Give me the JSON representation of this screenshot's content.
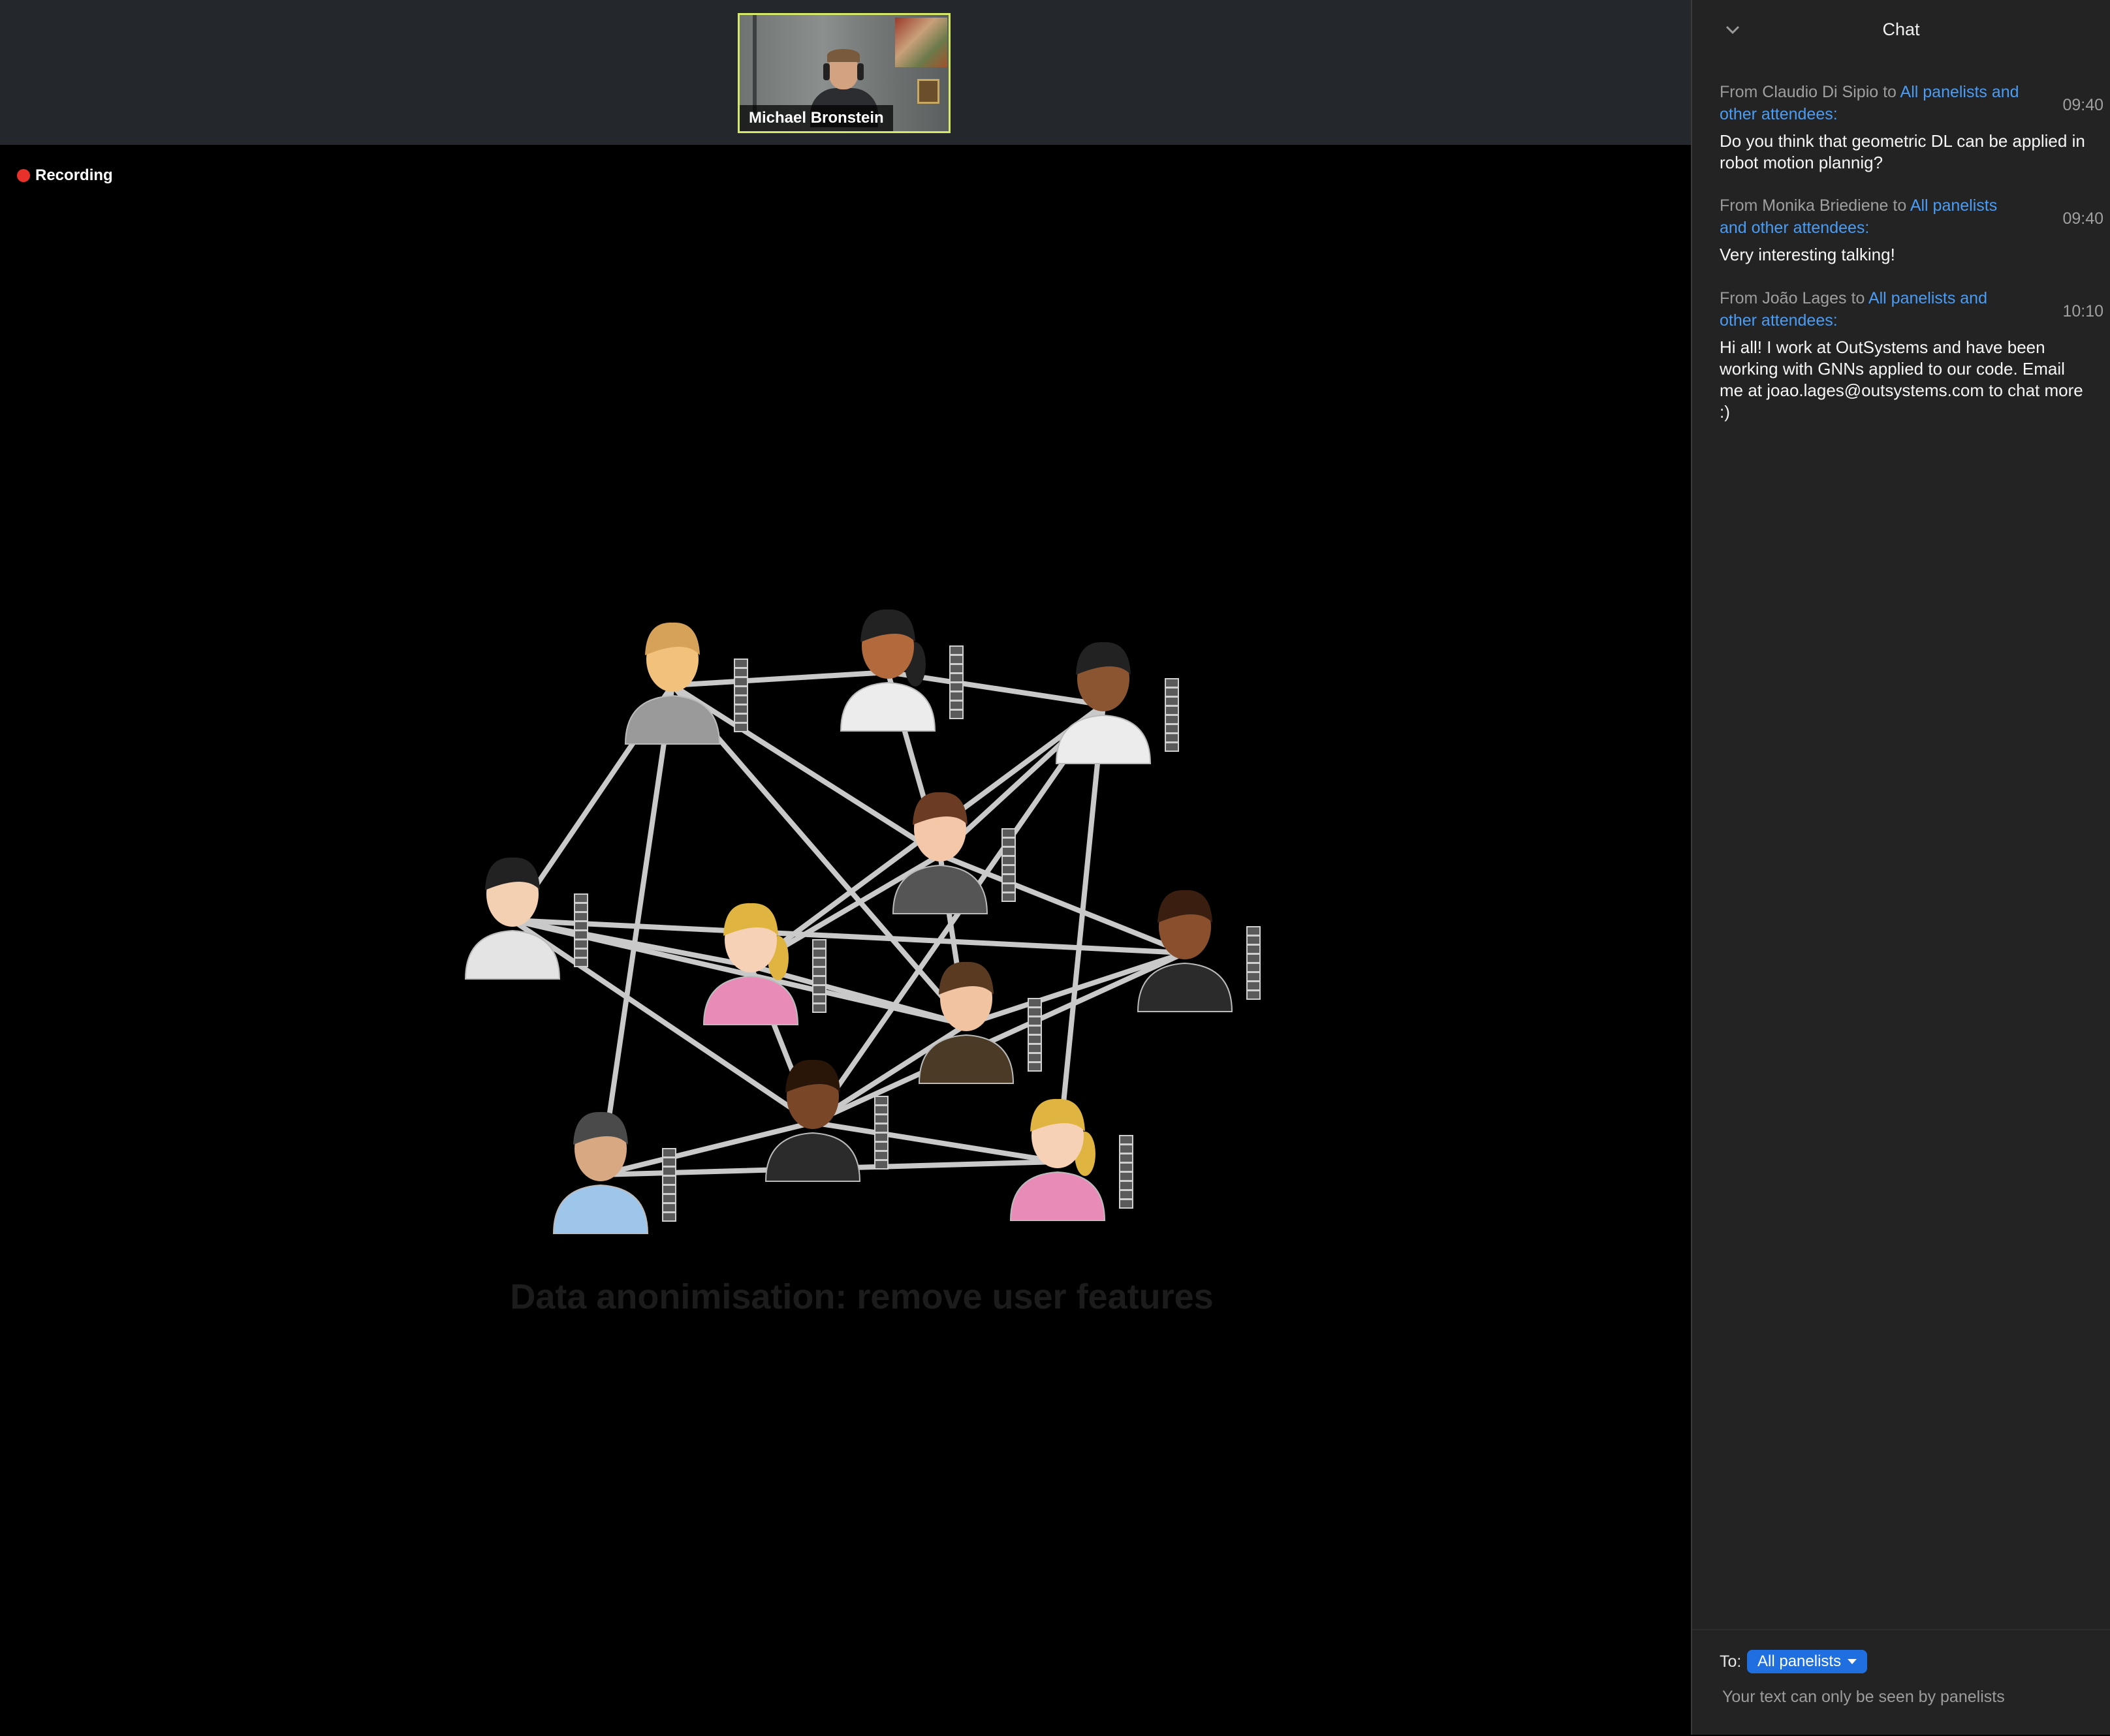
{
  "video": {
    "speaker_name": "Michael Bronstein",
    "recording_label": "Recording"
  },
  "slide": {
    "caption": "Data anonimisation: remove user features"
  },
  "chat": {
    "title": "Chat",
    "messages": [
      {
        "prefix": "From ",
        "sender": "Claudio Di Sipio",
        "to": " to ",
        "recipient": "All panelists and other attendees:",
        "time": "09:40",
        "text": "Do you think that geometric DL can be applied in robot motion plannig?"
      },
      {
        "prefix": "From ",
        "sender": "Monika Briediene",
        "to": " to ",
        "recipient": "All panelists and other attendees:",
        "time": "09:40",
        "text": "Very interesting talking!"
      },
      {
        "prefix": "From ",
        "sender": "João Lages",
        "to": " to ",
        "recipient": "All panelists and other attendees:",
        "time": "10:10",
        "text": "Hi all! I work at OutSystems and have been working with GNNs applied to our code. Email me at joao.lages@outsystems.com to chat more :)"
      }
    ],
    "to_label": "To:",
    "to_value": "All panelists",
    "privacy_note": "Your text can only be seen by panelists"
  },
  "icons": {
    "collapse": "chevron-down-icon",
    "recording": "recording-dot-icon",
    "dropdown": "caret-down-icon"
  },
  "colors": {
    "chat_bg": "#232323",
    "link_blue": "#4a9cf5",
    "select_blue": "#1f6fe0",
    "recording_red": "#e8312b",
    "active_speaker_border": "#d6e86a",
    "edge_gray": "#c9c9c9"
  }
}
